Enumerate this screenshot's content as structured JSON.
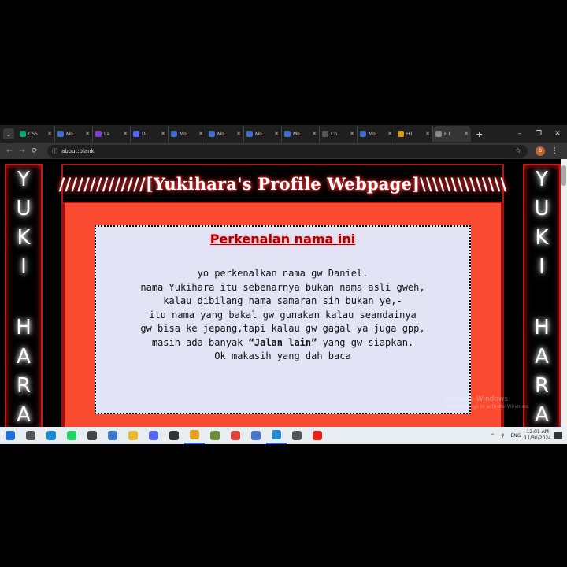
{
  "browser": {
    "tabs": [
      {
        "label": "CSS",
        "icon": "w3schools-icon",
        "color": "#04aa6d"
      },
      {
        "label": "Mo",
        "icon": "mdn-icon",
        "color": "#3e6cc8"
      },
      {
        "label": "La",
        "icon": "lalo-icon",
        "color": "#7a3fcf"
      },
      {
        "label": "Di",
        "icon": "discord-icon",
        "color": "#5865f2"
      },
      {
        "label": "Mo",
        "icon": "mdn-icon",
        "color": "#3e6cc8"
      },
      {
        "label": "Mo",
        "icon": "mdn-icon",
        "color": "#3e6cc8"
      },
      {
        "label": "Mo",
        "icon": "mdn-icon",
        "color": "#3e6cc8"
      },
      {
        "label": "Mo",
        "icon": "mdn-icon",
        "color": "#3e6cc8"
      },
      {
        "label": "Ch",
        "icon": "chatgpt-icon",
        "color": "#555555"
      },
      {
        "label": "Mo",
        "icon": "mdn-icon",
        "color": "#3e6cc8"
      },
      {
        "label": "HT",
        "icon": "html-icon",
        "color": "#d4a017"
      },
      {
        "label": "HT",
        "icon": "html-icon",
        "color": "#888888"
      }
    ],
    "url": "about:blank"
  },
  "page": {
    "side_letters": [
      "Y",
      "U",
      "K",
      "I",
      "",
      "",
      "H",
      "A",
      "R",
      "A"
    ],
    "header_title": "//////////////[Yukihara's  Profile  Webpage]\\\\\\\\\\\\\\\\\\\\\\\\\\\\",
    "card_title": "Perkenalan nama ini",
    "lines": {
      "l1": "yo perkenalkan nama gw Daniel.",
      "l2": "nama Yukihara itu sebenarnya bukan nama asli gweh,",
      "l3": "kalau dibilang nama samaran sih bukan ye,-",
      "l4": "itu nama yang bakal gw gunakan kalau seandainya",
      "l5": "gw bisa ke jepang,tapi kalau gw gagal ya juga gpp,",
      "l6_pre": "masih ada banyak ",
      "l6_bold": "“Jalan lain”",
      "l6_post": " yang gw siapkan.",
      "l7": "Ok makasih yang dah baca"
    }
  },
  "watermark": {
    "title": "Activate Windows",
    "subtitle": "Go to Settings to activate Windows."
  },
  "taskbar": {
    "icons": [
      {
        "name": "start-icon",
        "color": "#1e6fd9"
      },
      {
        "name": "search-icon",
        "color": "#555555"
      },
      {
        "name": "edge-icon",
        "color": "#1c8bd6"
      },
      {
        "name": "whatsapp-icon",
        "color": "#25d366"
      },
      {
        "name": "obs-icon",
        "color": "#444444"
      },
      {
        "name": "taskview-icon",
        "color": "#3a78c8"
      },
      {
        "name": "file-explorer-icon",
        "color": "#e8b830"
      },
      {
        "name": "discord-icon",
        "color": "#5865f2"
      },
      {
        "name": "settings-icon",
        "color": "#333333"
      },
      {
        "name": "chrome-canary-icon",
        "color": "#e2a020"
      },
      {
        "name": "minecraft-icon",
        "color": "#6b8e3d"
      },
      {
        "name": "chrome-icon",
        "color": "#db4437"
      },
      {
        "name": "store-icon",
        "color": "#4a74c9"
      },
      {
        "name": "vscode-icon",
        "color": "#1f8ad2"
      },
      {
        "name": "unity-icon",
        "color": "#555555"
      },
      {
        "name": "youtube-icon",
        "color": "#e62117"
      }
    ],
    "lang": "ENG",
    "time": "12:01 AM",
    "date": "11/30/2024"
  }
}
